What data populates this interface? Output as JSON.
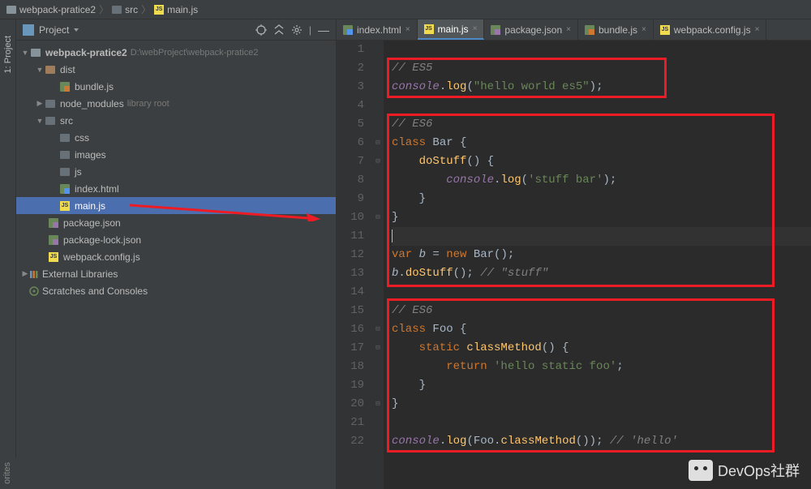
{
  "breadcrumb": [
    {
      "icon": "folder",
      "label": "webpack-pratice2"
    },
    {
      "icon": "folder-dark",
      "label": "src"
    },
    {
      "icon": "js",
      "label": "main.js"
    }
  ],
  "project_toolbar": {
    "title": "Project"
  },
  "side_tab": {
    "project": "1: Project",
    "favorites": "orites"
  },
  "tree": {
    "root": {
      "label": "webpack-pratice2",
      "path": "D:\\webProject\\webpack-pratice2"
    },
    "dist": {
      "label": "dist"
    },
    "bundle": {
      "label": "bundle.js"
    },
    "node_modules": {
      "label": "node_modules",
      "hint": "library root"
    },
    "src": {
      "label": "src"
    },
    "css": {
      "label": "css"
    },
    "images": {
      "label": "images"
    },
    "js": {
      "label": "js"
    },
    "index_html": {
      "label": "index.html"
    },
    "main_js": {
      "label": "main.js"
    },
    "package_json": {
      "label": "package.json"
    },
    "package_lock": {
      "label": "package-lock.json"
    },
    "webpack_config": {
      "label": "webpack.config.js"
    },
    "external_libs": {
      "label": "External Libraries"
    },
    "scratches": {
      "label": "Scratches and Consoles"
    }
  },
  "editor_tabs": [
    {
      "icon": "html",
      "label": "index.html"
    },
    {
      "icon": "js",
      "label": "main.js",
      "active": true
    },
    {
      "icon": "json",
      "label": "package.json"
    },
    {
      "icon": "js101",
      "label": "bundle.js"
    },
    {
      "icon": "js",
      "label": "webpack.config.js"
    }
  ],
  "code": {
    "lines": [
      {
        "n": 1,
        "raw": ""
      },
      {
        "n": 2,
        "tokens": [
          {
            "t": "// ES5",
            "c": "c-comment"
          }
        ]
      },
      {
        "n": 3,
        "tokens": [
          {
            "t": "console",
            "c": "c-obj"
          },
          {
            "t": "."
          },
          {
            "t": "log",
            "c": "c-method"
          },
          {
            "t": "("
          },
          {
            "t": "\"hello world es5\"",
            "c": "c-string"
          },
          {
            "t": ");"
          }
        ]
      },
      {
        "n": 4,
        "raw": ""
      },
      {
        "n": 5,
        "tokens": [
          {
            "t": "// ES6",
            "c": "c-comment"
          }
        ]
      },
      {
        "n": 6,
        "tokens": [
          {
            "t": "class ",
            "c": "c-keyword"
          },
          {
            "t": "Bar {"
          }
        ]
      },
      {
        "n": 7,
        "tokens": [
          {
            "t": "    "
          },
          {
            "t": "doStuff",
            "c": "c-method"
          },
          {
            "t": "() {"
          }
        ]
      },
      {
        "n": 8,
        "tokens": [
          {
            "t": "        "
          },
          {
            "t": "console",
            "c": "c-obj"
          },
          {
            "t": "."
          },
          {
            "t": "log",
            "c": "c-method"
          },
          {
            "t": "("
          },
          {
            "t": "'stuff bar'",
            "c": "c-string"
          },
          {
            "t": ");"
          }
        ]
      },
      {
        "n": 9,
        "tokens": [
          {
            "t": "    }"
          }
        ]
      },
      {
        "n": 10,
        "tokens": [
          {
            "t": "}"
          }
        ]
      },
      {
        "n": 11,
        "current": true,
        "tokens": [
          {
            "t": "",
            "caret": true
          }
        ]
      },
      {
        "n": 12,
        "tokens": [
          {
            "t": "var ",
            "c": "c-keyword"
          },
          {
            "t": "b",
            "c": "c-ident"
          },
          {
            "t": " = "
          },
          {
            "t": "new ",
            "c": "c-keyword"
          },
          {
            "t": "Bar();"
          }
        ]
      },
      {
        "n": 13,
        "tokens": [
          {
            "t": "b",
            "c": "c-ident"
          },
          {
            "t": "."
          },
          {
            "t": "doStuff",
            "c": "c-method"
          },
          {
            "t": "(); "
          },
          {
            "t": "// \"stuff\"",
            "c": "c-comment"
          }
        ]
      },
      {
        "n": 14,
        "raw": ""
      },
      {
        "n": 15,
        "tokens": [
          {
            "t": "// ES6",
            "c": "c-comment"
          }
        ]
      },
      {
        "n": 16,
        "tokens": [
          {
            "t": "class ",
            "c": "c-keyword"
          },
          {
            "t": "Foo {"
          }
        ]
      },
      {
        "n": 17,
        "tokens": [
          {
            "t": "    "
          },
          {
            "t": "static ",
            "c": "c-keyword"
          },
          {
            "t": "classMethod",
            "c": "c-method"
          },
          {
            "t": "() {"
          }
        ]
      },
      {
        "n": 18,
        "tokens": [
          {
            "t": "        "
          },
          {
            "t": "return ",
            "c": "c-keyword"
          },
          {
            "t": "'hello static foo'",
            "c": "c-string"
          },
          {
            "t": ";"
          }
        ]
      },
      {
        "n": 19,
        "tokens": [
          {
            "t": "    }"
          }
        ]
      },
      {
        "n": 20,
        "tokens": [
          {
            "t": "}"
          }
        ]
      },
      {
        "n": 21,
        "raw": ""
      },
      {
        "n": 22,
        "tokens": [
          {
            "t": "console",
            "c": "c-obj"
          },
          {
            "t": "."
          },
          {
            "t": "log",
            "c": "c-method"
          },
          {
            "t": "(Foo."
          },
          {
            "t": "classMethod",
            "c": "c-method"
          },
          {
            "t": "()); "
          },
          {
            "t": "// 'hello'",
            "c": "c-comment"
          }
        ]
      }
    ],
    "fold_markers": {
      "6": "⊟",
      "7": "⊟",
      "10": "⊟",
      "16": "⊟",
      "17": "⊟",
      "20": "⊟"
    }
  },
  "watermark": "DevOps社群"
}
